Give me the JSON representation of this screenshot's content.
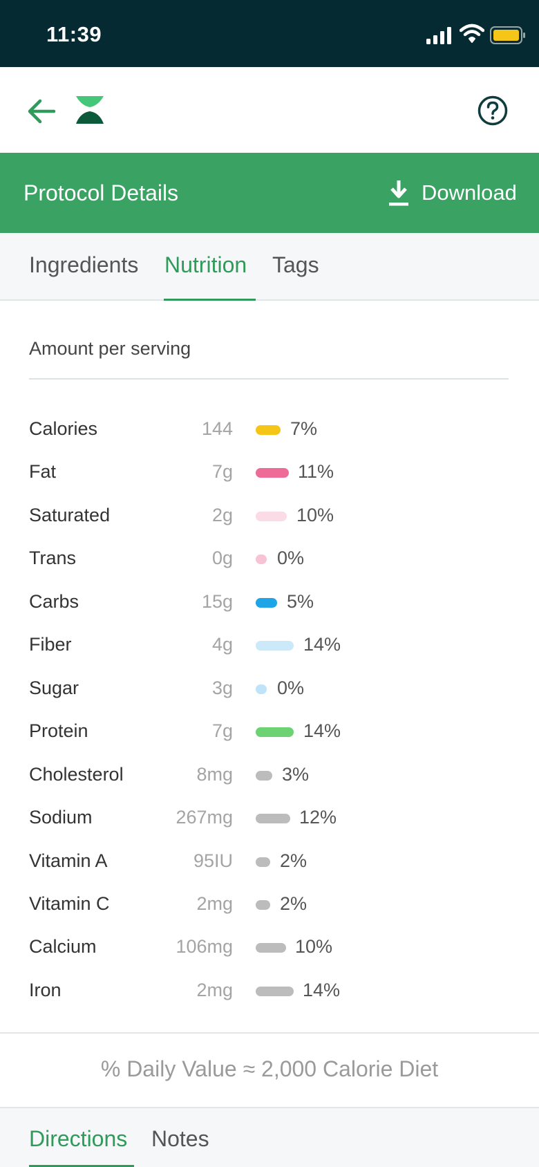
{
  "status_bar": {
    "time": "11:39",
    "battery_color": "#f5c518"
  },
  "nav": {
    "back_icon": "arrow-left-icon",
    "logo_icon": "app-logo-icon",
    "help_icon": "question-circle-icon"
  },
  "banner": {
    "title": "Protocol Details",
    "download_label": "Download",
    "color": "#3aa363"
  },
  "tabs": [
    {
      "label": "Ingredients",
      "active": false
    },
    {
      "label": "Nutrition",
      "active": true
    },
    {
      "label": "Tags",
      "active": false
    }
  ],
  "nutrition": {
    "header": "Amount per serving",
    "rows": [
      {
        "name": "Calories",
        "amount": "144",
        "percent": "7%",
        "color": "#f5c518"
      },
      {
        "name": "Fat",
        "amount": "7g",
        "percent": "11%",
        "color": "#ee6b97"
      },
      {
        "name": "Saturated",
        "amount": "2g",
        "percent": "10%",
        "color": "#fadbe6"
      },
      {
        "name": "Trans",
        "amount": "0g",
        "percent": "0%",
        "color": "#f7c4d5"
      },
      {
        "name": "Carbs",
        "amount": "15g",
        "percent": "5%",
        "color": "#1ea5e8"
      },
      {
        "name": "Fiber",
        "amount": "4g",
        "percent": "14%",
        "color": "#cce9fa"
      },
      {
        "name": "Sugar",
        "amount": "3g",
        "percent": "0%",
        "color": "#bfe3f8"
      },
      {
        "name": "Protein",
        "amount": "7g",
        "percent": "14%",
        "color": "#6cd273"
      },
      {
        "name": "Cholesterol",
        "amount": "8mg",
        "percent": "3%",
        "color": "#bcbcbc"
      },
      {
        "name": "Sodium",
        "amount": "267mg",
        "percent": "12%",
        "color": "#bcbcbc"
      },
      {
        "name": "Vitamin A",
        "amount": "95IU",
        "percent": "2%",
        "color": "#bcbcbc"
      },
      {
        "name": "Vitamin C",
        "amount": "2mg",
        "percent": "2%",
        "color": "#bcbcbc"
      },
      {
        "name": "Calcium",
        "amount": "106mg",
        "percent": "10%",
        "color": "#bcbcbc"
      },
      {
        "name": "Iron",
        "amount": "2mg",
        "percent": "14%",
        "color": "#bcbcbc"
      }
    ],
    "footnote": "% Daily Value ≈ 2,000 Calorie Diet"
  },
  "bottom_tabs": [
    {
      "label": "Directions",
      "active": true
    },
    {
      "label": "Notes",
      "active": false
    }
  ],
  "accent": "#2f9a5a"
}
